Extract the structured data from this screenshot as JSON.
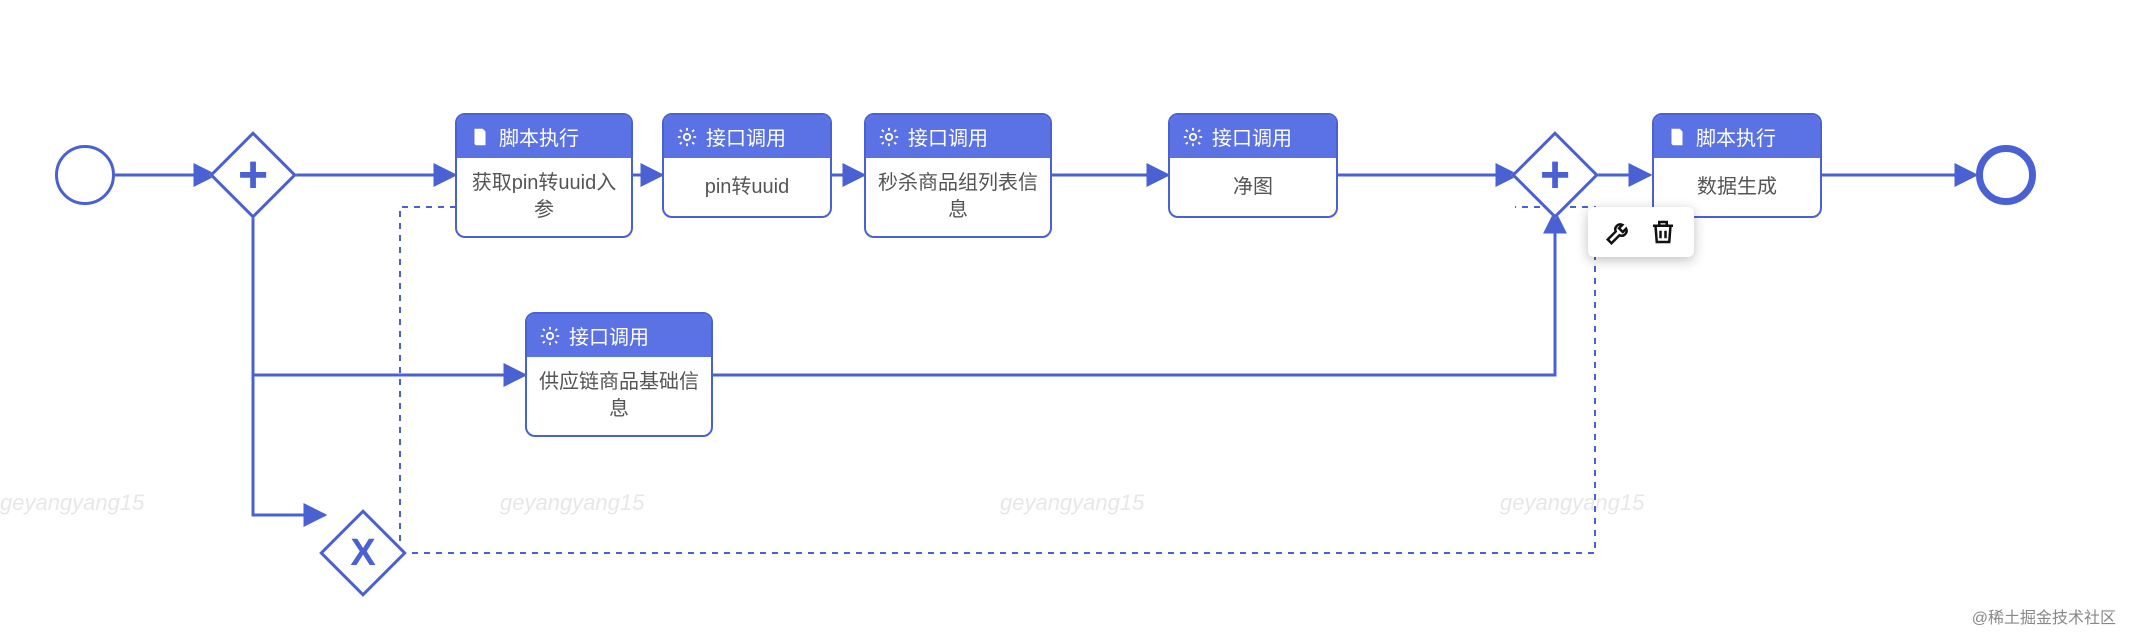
{
  "node_types": {
    "script": "脚本执行",
    "api": "接口调用"
  },
  "tasks": {
    "get_pin_param": {
      "type": "script",
      "label": "获取pin转uuid入参"
    },
    "pin_to_uuid": {
      "type": "api",
      "label": "pin转uuid"
    },
    "seckill_list": {
      "type": "api",
      "label": "秒杀商品组列表信息"
    },
    "clean_image": {
      "type": "api",
      "label": "净图"
    },
    "supply_chain": {
      "type": "api",
      "label": "供应链商品基础信息"
    },
    "generate_data": {
      "type": "script",
      "label": "数据生成"
    }
  },
  "gateways": {
    "parallel_split": "parallel",
    "parallel_join": "parallel",
    "exclusive_end": "exclusive"
  },
  "watermark_text": "geyangyang15",
  "attribution": "@稀土掘金技术社区",
  "colors": {
    "accent": "#4a61d3",
    "header": "#5b72e4"
  }
}
